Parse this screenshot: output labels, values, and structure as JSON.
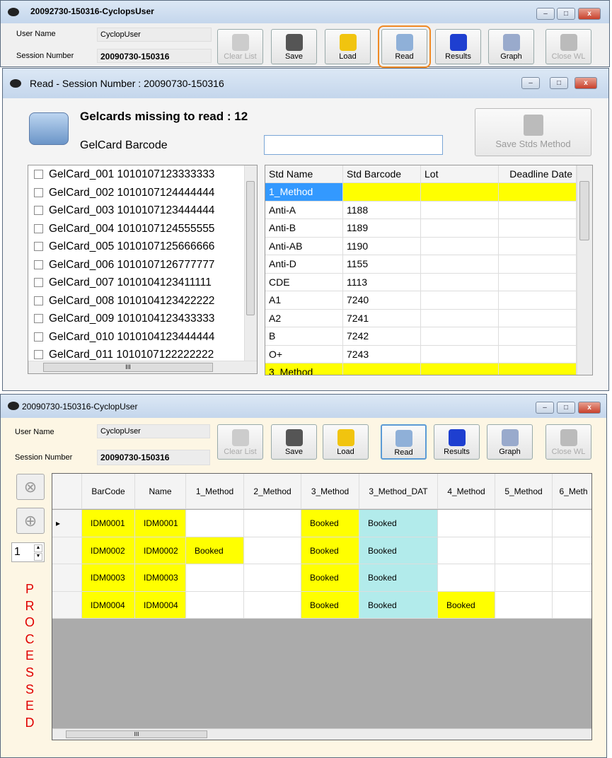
{
  "main_window": {
    "title": "20092730-150316-CyclopsUser",
    "user_name_label": "User Name",
    "user_name": "CyclopUser",
    "session_label": "Session Number",
    "session": "20090730-150316",
    "toolbar": [
      {
        "label": "Clear List",
        "icon": "clear-list-icon",
        "enabled": false
      },
      {
        "label": "Save",
        "icon": "floppy-disk-icon",
        "enabled": true
      },
      {
        "label": "Load",
        "icon": "folder-icon",
        "enabled": true
      },
      {
        "label": "Read",
        "icon": "camera-icon",
        "enabled": true,
        "active": true
      },
      {
        "label": "Results",
        "icon": "results-binder-icon",
        "enabled": true
      },
      {
        "label": "Graph",
        "icon": "graph-icon",
        "enabled": true
      },
      {
        "label": "Close WL",
        "icon": "check-circle-icon",
        "enabled": false
      }
    ]
  },
  "read_window": {
    "title": "Read  -  Session Number : 20090730-150316",
    "missing_text": "Gelcards missing to read : 12",
    "barcode_label": "GelCard Barcode",
    "barcode_value": "",
    "save_button": "Save Stds Method",
    "gelcards": [
      "GelCard_001 1010107123333333",
      "GelCard_002 1010107124444444",
      "GelCard_003 1010107123444444",
      "GelCard_004 1010107124555555",
      "GelCard_005 1010107125666666",
      "GelCard_006 1010107126777777",
      "GelCard_007 1010104123411111",
      "GelCard_008 1010104123422222",
      "GelCard_009 1010104123433333",
      "GelCard_010 1010104123444444",
      "GelCard_011 1010107122222222"
    ],
    "std_columns": [
      "Std Name",
      "Std Barcode",
      "Lot",
      "Deadline Date"
    ],
    "std_rows": [
      [
        "1_Method",
        "",
        "",
        ""
      ],
      [
        "Anti-A",
        "1188",
        "",
        ""
      ],
      [
        "Anti-B",
        "1189",
        "",
        ""
      ],
      [
        "Anti-AB",
        "1190",
        "",
        ""
      ],
      [
        "Anti-D",
        "1155",
        "",
        ""
      ],
      [
        "CDE",
        "1113",
        "",
        ""
      ],
      [
        "A1",
        "7240",
        "",
        ""
      ],
      [
        "A2",
        "7241",
        "",
        ""
      ],
      [
        "B",
        "7242",
        "",
        ""
      ],
      [
        "O+",
        "7243",
        "",
        ""
      ],
      [
        "3_Method",
        "",
        "",
        ""
      ]
    ],
    "method_rows": [
      0,
      10
    ],
    "hscroll_glyph": "III"
  },
  "worklist_window": {
    "title": "20090730-150316-CyclopUser",
    "user_name_label": "User Name",
    "user_name": "CyclopUser",
    "session_label": "Session Number",
    "session": "20090730-150316",
    "spinner_value": "1",
    "status_text": "PROCESSED",
    "columns": [
      "BarCode",
      "Name",
      "1_Method",
      "2_Method",
      "3_Method",
      "3_Method_DAT",
      "4_Method",
      "5_Method",
      "6_Meth"
    ],
    "rows": [
      [
        "IDM0001",
        "IDM0001",
        "",
        "",
        "Booked",
        "Booked",
        "",
        "",
        ""
      ],
      [
        "IDM0002",
        "IDM0002",
        "Booked",
        "",
        "Booked",
        "Booked",
        "",
        "",
        ""
      ],
      [
        "IDM0003",
        "IDM0003",
        "",
        "",
        "Booked",
        "Booked",
        "",
        "",
        ""
      ],
      [
        "IDM0004",
        "IDM0004",
        "",
        "",
        "Booked",
        "Booked",
        "Booked",
        "",
        ""
      ]
    ],
    "hscroll_glyph": "III"
  },
  "colors": {
    "booked_method": "#ffff00",
    "booked_dat": "#b2ebeb",
    "selected": "#3399ff",
    "active_outline": "#f08a24",
    "processed": "#e00000"
  }
}
